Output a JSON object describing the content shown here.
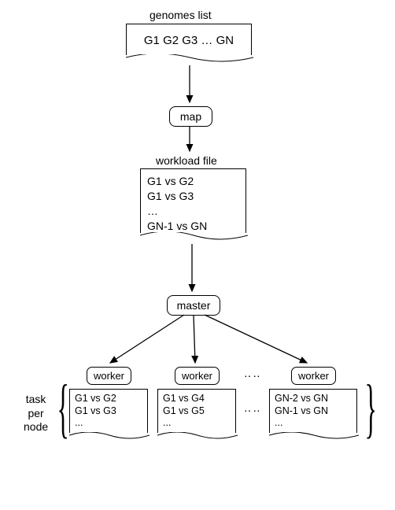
{
  "title_genomes": "genomes list",
  "genomes_content": "G1 G2 G3 … GN",
  "map_label": "map",
  "title_workload": "workload file",
  "workload_lines": {
    "l1": "G1 vs G2",
    "l2": "G1 vs G3",
    "l3": "…",
    "l4": "GN-1 vs GN"
  },
  "master_label": "master",
  "worker_label": "worker",
  "ellipsis": "‥‥",
  "task_per_node_l1": "task",
  "task_per_node_l2": "per",
  "task_per_node_l3": "node",
  "workers": {
    "w1": {
      "l1": "G1 vs G2",
      "l2": "G1 vs G3",
      "l3": "..."
    },
    "w2": {
      "l1": "G1 vs G4",
      "l2": "G1 vs G5",
      "l3": "..."
    },
    "w3": {
      "l1": "GN-2 vs GN",
      "l2": "GN-1 vs GN",
      "l3": "..."
    }
  }
}
